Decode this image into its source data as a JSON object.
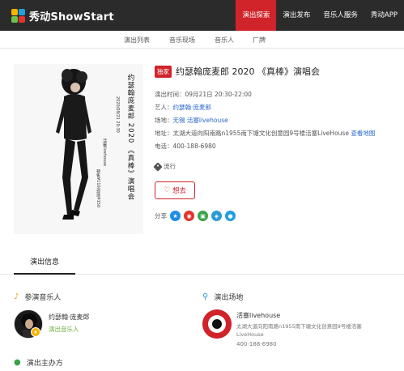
{
  "brand": {
    "logo_text": "秀动ShowStart"
  },
  "nav": {
    "items": [
      {
        "label": "演出探索",
        "active": true
      },
      {
        "label": "演出发布",
        "active": false
      },
      {
        "label": "音乐人服务",
        "active": false
      },
      {
        "label": "秀动APP",
        "active": false
      }
    ]
  },
  "subnav": {
    "items": [
      "演出列表",
      "音乐现场",
      "音乐人",
      "厂牌"
    ]
  },
  "event": {
    "badge": "独家",
    "title": "约瑟翰庞麦郎 2020 《真棒》演唱会",
    "time_label": "演出时间：",
    "time_value": "09月21日 20:30-22:00",
    "artist_label": "艺人：",
    "artist_value": "约瑟翰·庞麦郎",
    "venue_label": "场地：",
    "venue_city": "无锡",
    "venue_name": "活塞livehouse",
    "address_label": "地址：",
    "address_value": "太湖大道向阳南路n1955南下塘文化创意园9号楼活塞LiveHouse",
    "map_link": "查看地图",
    "phone_label": "电话：",
    "phone_value": "400-188-6980",
    "tag": "流行",
    "want_label": "想去",
    "share_label": "分享"
  },
  "poster": {
    "title_vertical": "约瑟翰庞麦郎 2020 《真棒》演唱会",
    "date_vertical": "2020/09/21 20:30",
    "venue_vertical": "活塞livehouse",
    "price_vertical": "预售¥110/现场¥150"
  },
  "tabs": {
    "active_label": "演出信息"
  },
  "artists_section": {
    "heading": "参演音乐人",
    "artist_name": "约瑟翰·庞麦郎",
    "artist_role": "演出音乐人"
  },
  "venue_section": {
    "heading": "演出场地",
    "name": "活塞livehouse",
    "address": "太湖大道向阳南路n1955南下塘文化创意园9号楼活塞LiveHouse",
    "phone": "400-188-6980"
  },
  "organizer_section": {
    "heading": "演出主办方"
  },
  "share_icons": [
    {
      "name": "qzone-icon",
      "color": "#1e8fe1"
    },
    {
      "name": "weibo-icon",
      "color": "#e2332e"
    },
    {
      "name": "douban-icon",
      "color": "#3aa34a"
    },
    {
      "name": "tieba-icon",
      "color": "#2a9bd6"
    },
    {
      "name": "qq-icon",
      "color": "#1ea0e1"
    }
  ],
  "colors": {
    "accent": "#d0232a",
    "link": "#2a67c9",
    "green": "#6cae3c"
  }
}
